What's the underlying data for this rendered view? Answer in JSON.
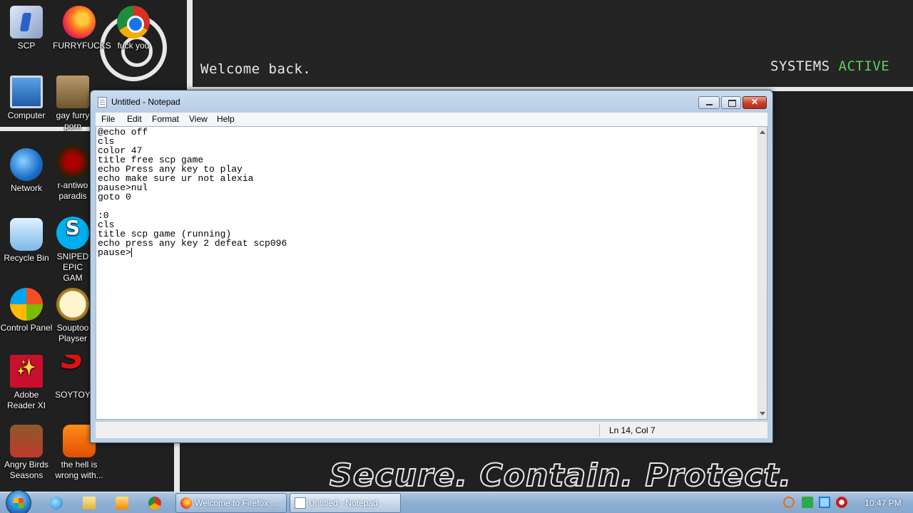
{
  "wallpaper": {
    "welcome": "Welcome back.",
    "systems_label": "SYSTEMS",
    "systems_status": "ACTIVE",
    "slogan": "Secure. Contain. Protect."
  },
  "desktop_icons": [
    {
      "label": "SCP",
      "icon": "scp-shortcut-icon"
    },
    {
      "label": "FURRYFUCKS",
      "icon": "firefox-icon"
    },
    {
      "label": "fuck you",
      "icon": "chrome-icon"
    },
    {
      "label": "Computer",
      "icon": "computer-icon"
    },
    {
      "label": "gay furry porn",
      "icon": "bozo-icon"
    },
    {
      "label": "Network",
      "icon": "network-icon"
    },
    {
      "label": "r-antiwo paradis",
      "icon": "red-app-icon"
    },
    {
      "label": "Recycle Bin",
      "icon": "recycle-bin-icon"
    },
    {
      "label": "SNIPED EPIC GAM",
      "icon": "skype-icon"
    },
    {
      "label": "Control Panel",
      "icon": "control-panel-icon"
    },
    {
      "label": "Souptoo Playser",
      "icon": "clock-app-icon"
    },
    {
      "label": "Adobe Reader XI",
      "icon": "adobe-reader-icon"
    },
    {
      "label": "SOYTOY",
      "icon": "soytoy-icon"
    },
    {
      "label": "Angry Birds Seasons",
      "icon": "angry-birds-icon"
    },
    {
      "label": "the hell is wrong with...",
      "icon": "orange-app-icon"
    }
  ],
  "notepad": {
    "title": "Untitled - Notepad",
    "menu": [
      "File",
      "Edit",
      "Format",
      "View",
      "Help"
    ],
    "content": "@echo off\ncls\ncolor 47\ntitle free scp game\necho Press any key to play\necho make sure ur not alexia\npause>nul\ngoto 0\n\n:0\ncls\ntitle scp game (running)\necho press any key 2 defeat scp096\npause>",
    "status_position": "Ln 14, Col 7"
  },
  "taskbar": {
    "tasks": [
      "Welcome to Firefox ...",
      "Untitled - Notepad"
    ],
    "clock": "10:47 PM"
  }
}
